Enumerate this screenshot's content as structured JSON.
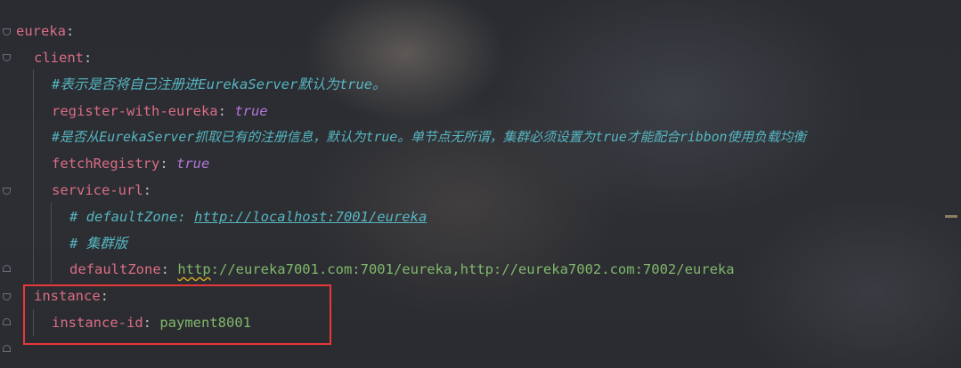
{
  "editor": {
    "lines": [
      {
        "key": "eureka",
        "colon": ":"
      },
      {
        "key": "client",
        "colon": ":"
      },
      {
        "comment": "#表示是否将自己注册进EurekaServer默认为true。"
      },
      {
        "key": "register-with-eureka",
        "colon": ": ",
        "value": "true"
      },
      {
        "comment": "#是否从EurekaServer抓取已有的注册信息，默认为true。单节点无所谓，集群必须设置为true才能配合ribbon使用负载均衡"
      },
      {
        "key": "fetchRegistry",
        "colon": ": ",
        "value": "true"
      },
      {
        "key": "service-url",
        "colon": ":"
      },
      {
        "comment_prefix": "# defaultZone: ",
        "link": "http://localhost:7001/eureka"
      },
      {
        "comment": "# 集群版"
      },
      {
        "key": "defaultZone",
        "colon": ": ",
        "value_squiggle": "http",
        "value_rest": "://eureka7001.com:7001/eureka,http://eureka7002.com:7002/eureka"
      },
      {
        "key": "instance",
        "colon": ":"
      },
      {
        "key": "instance-id",
        "colon": ": ",
        "value": "payment8001"
      }
    ]
  },
  "colors": {
    "key": "#d96d84",
    "boolean": "#b377d9",
    "string": "#7fb86b",
    "comment": "#56b6c2",
    "highlight_box": "#e8383a"
  }
}
